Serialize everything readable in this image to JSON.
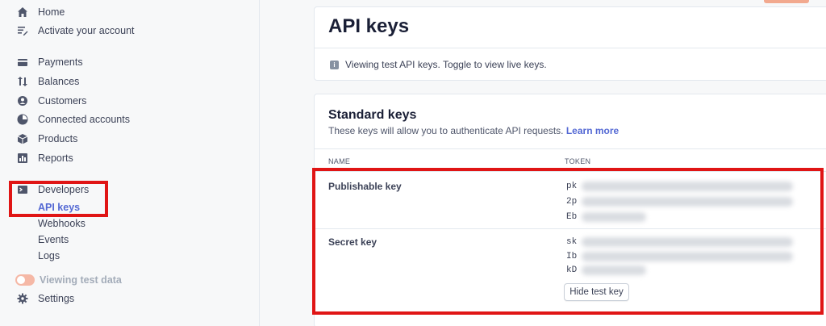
{
  "sidebar": {
    "top": [
      {
        "label": "Home",
        "icon": "home-icon"
      },
      {
        "label": "Activate your account",
        "icon": "activate-icon"
      }
    ],
    "items": [
      {
        "label": "Payments",
        "icon": "payments-icon"
      },
      {
        "label": "Balances",
        "icon": "balances-icon"
      },
      {
        "label": "Customers",
        "icon": "customers-icon"
      },
      {
        "label": "Connected accounts",
        "icon": "connected-accounts-icon"
      },
      {
        "label": "Products",
        "icon": "products-icon"
      },
      {
        "label": "Reports",
        "icon": "reports-icon"
      }
    ],
    "developers": {
      "label": "Developers",
      "icon": "terminal-icon",
      "sub": [
        "API keys",
        "Webhooks",
        "Events",
        "Logs"
      ],
      "active": "API keys"
    },
    "test_data_label": "Viewing test data",
    "settings_label": "Settings"
  },
  "page": {
    "title": "API keys",
    "notice": "Viewing test API keys. Toggle to view live keys."
  },
  "standard_keys": {
    "title": "Standard keys",
    "description": "These keys will allow you to authenticate API requests.",
    "learn_more": "Learn more",
    "columns": {
      "name": "NAME",
      "token": "TOKEN"
    },
    "publishable": {
      "label": "Publishable key",
      "lines": [
        "pk",
        "2p",
        "Eb"
      ]
    },
    "secret": {
      "label": "Secret key",
      "lines": [
        "sk",
        "Ib",
        "kD"
      ]
    },
    "hide_button": "Hide test key"
  },
  "colors": {
    "accent": "#5469d4",
    "highlight_border": "#e01515",
    "toggle": "#f5b8a6"
  }
}
